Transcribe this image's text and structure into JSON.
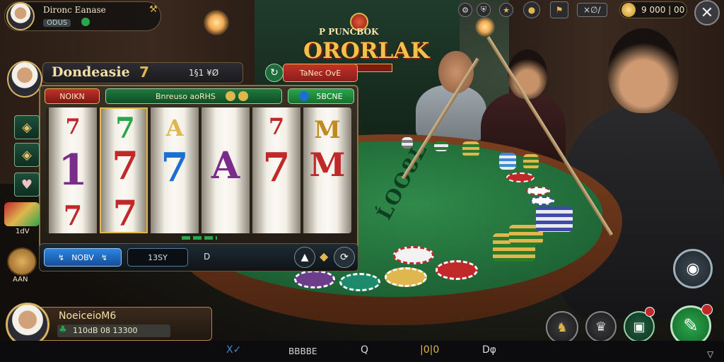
{
  "player_card": {
    "name": "Dironc Eanase",
    "balance": "ODUS"
  },
  "logo": {
    "top": "P PUNCBOK",
    "main": "ORORLAK"
  },
  "top_right": {
    "badge_text": "×∅∕",
    "coins": "9 000 | 00"
  },
  "slot": {
    "title": "Dondeasie",
    "title_badge": "7",
    "title_stats": "1§1  ¥Ø",
    "side_tab": "TaNec OvE",
    "bar_left": "NOIKN",
    "bar_mid": "Bnreuso aoRHS",
    "bar_right": "5BCNE",
    "reels": [
      [
        "7",
        "1",
        "7"
      ],
      [
        "7",
        "7",
        "7"
      ],
      [
        "A",
        "7",
        ""
      ],
      [
        "",
        "A",
        ""
      ],
      [
        "7",
        "7",
        ""
      ],
      [
        "M",
        "M",
        ""
      ]
    ],
    "footer_left": "NOBV",
    "footer_mid": "13SY",
    "footer_small": "D"
  },
  "left_widgets": {
    "bag_label": "1dV",
    "coin_label": "AAN"
  },
  "bottom_player": {
    "name": "NoeiceioM6",
    "amount": "110dB 08 13300"
  },
  "felt_text": "ĹOO8L",
  "bottom_bar": [
    "Ⅹ✓",
    "BBBBE",
    "Q",
    "|0|0",
    "Dφ"
  ],
  "colors": {
    "accent_gold": "#e0b64e",
    "accent_green": "#2aa64a",
    "accent_red": "#c0282a",
    "accent_blue": "#1d6fcf"
  }
}
